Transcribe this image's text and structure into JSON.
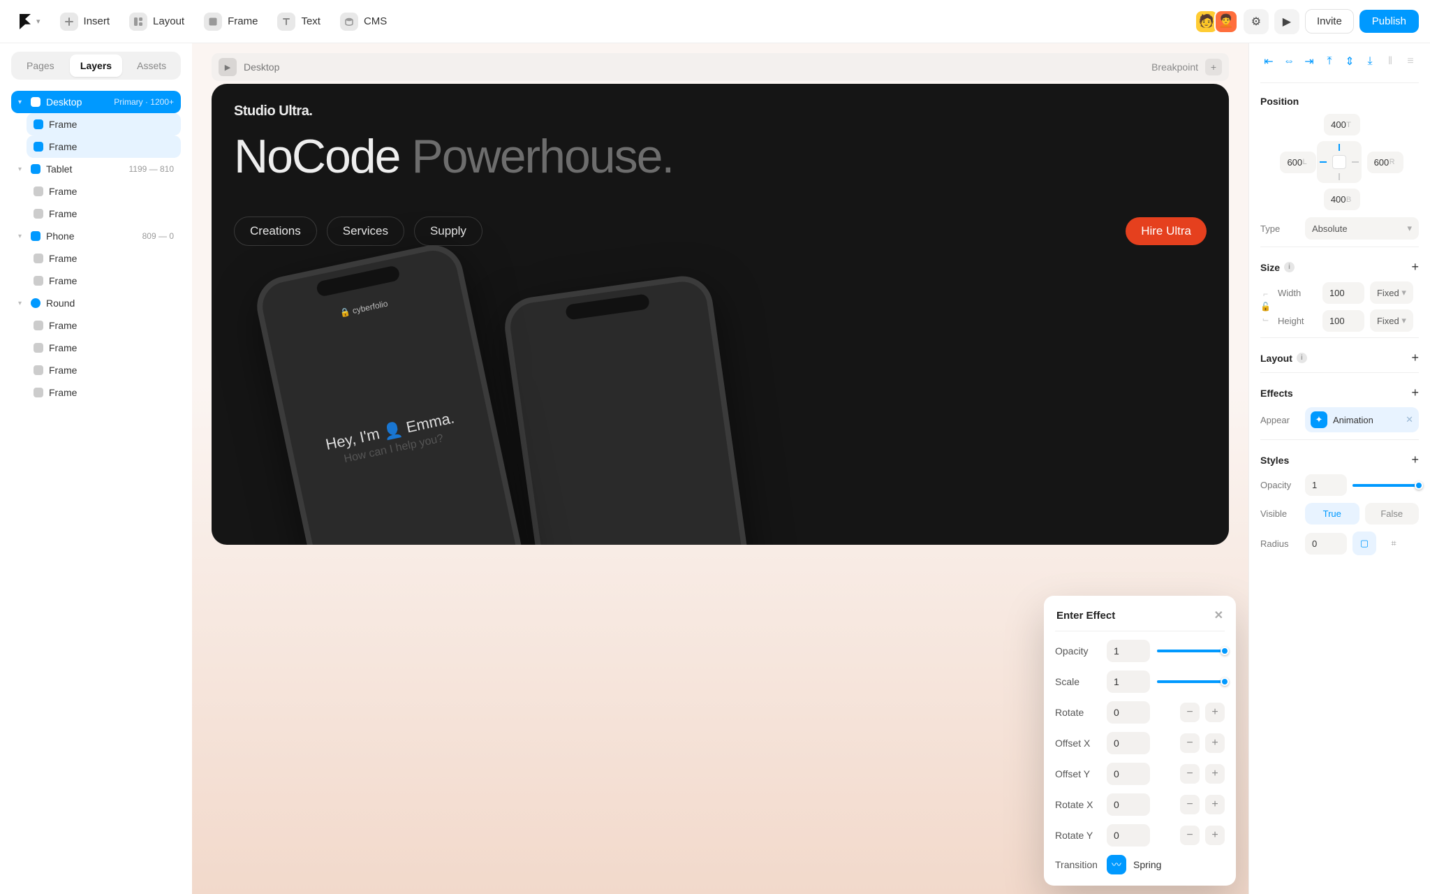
{
  "toolbar": {
    "insert": "Insert",
    "layout": "Layout",
    "frame": "Frame",
    "text": "Text",
    "cms": "CMS",
    "invite": "Invite",
    "publish": "Publish"
  },
  "left": {
    "tabs": {
      "pages": "Pages",
      "layers": "Layers",
      "assets": "Assets"
    },
    "tree": {
      "desktop": {
        "label": "Desktop",
        "meta": "Primary · 1200+"
      },
      "frame": "Frame",
      "tablet": {
        "label": "Tablet",
        "meta": "1199 — 810"
      },
      "phone": {
        "label": "Phone",
        "meta": "809 — 0"
      },
      "round": {
        "label": "Round"
      }
    }
  },
  "canvas": {
    "breakpoint_label": "Desktop",
    "breakpoint_right": "Breakpoint",
    "brand": "Studio Ultra.",
    "hero_a": "NoCode",
    "hero_b": "Powerhouse.",
    "nav": {
      "a": "Creations",
      "b": "Services",
      "c": "Supply",
      "cta": "Hire Ultra"
    },
    "phone": {
      "url": "cyberfolio",
      "hello": "Hey, I'm",
      "name": "Emma.",
      "sub": "How can I help you?"
    }
  },
  "popover": {
    "title": "Enter Effect",
    "rows": {
      "opacity": {
        "label": "Opacity",
        "value": "1"
      },
      "scale": {
        "label": "Scale",
        "value": "1"
      },
      "rotate": {
        "label": "Rotate",
        "value": "0"
      },
      "offsetx": {
        "label": "Offset X",
        "value": "0"
      },
      "offsety": {
        "label": "Offset Y",
        "value": "0"
      },
      "rotatex": {
        "label": "Rotate X",
        "value": "0"
      },
      "rotatey": {
        "label": "Rotate Y",
        "value": "0"
      },
      "transition": {
        "label": "Transition",
        "value": "Spring"
      }
    }
  },
  "right": {
    "position": {
      "title": "Position",
      "top": "400",
      "left": "600",
      "right": "600",
      "bottom": "400",
      "type_label": "Type",
      "type_value": "Absolute"
    },
    "size": {
      "title": "Size",
      "width_label": "Width",
      "width_value": "100",
      "width_mode": "Fixed",
      "height_label": "Height",
      "height_value": "100",
      "height_mode": "Fixed"
    },
    "layout": {
      "title": "Layout"
    },
    "effects": {
      "title": "Effects",
      "appear_label": "Appear",
      "animation": "Animation"
    },
    "styles": {
      "title": "Styles",
      "opacity_label": "Opacity",
      "opacity_value": "1",
      "visible_label": "Visible",
      "true": "True",
      "false": "False",
      "radius_label": "Radius",
      "radius_value": "0"
    }
  }
}
